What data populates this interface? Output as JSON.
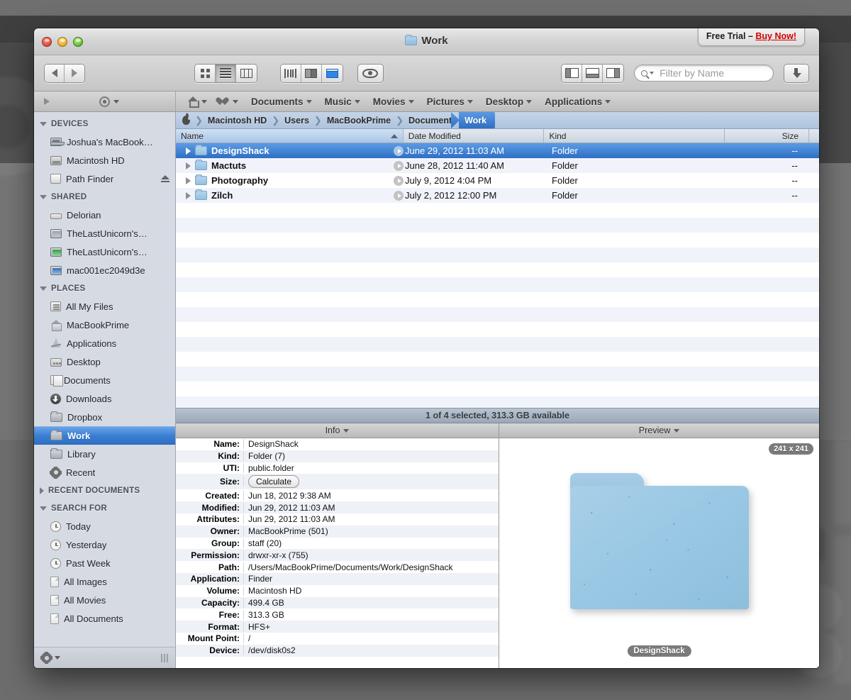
{
  "window": {
    "title": "Work",
    "trial": {
      "prefix": "Free Trial – ",
      "buy": "Buy Now!"
    }
  },
  "toolbar": {
    "back_label": "Back",
    "forward_label": "Forward",
    "view_icon_label": "Icon View",
    "view_list_label": "List View",
    "view_column_label": "Column View",
    "browser_slim_label": "Slim Browser",
    "browser_dual_label": "Dual Browser",
    "browser_single_label": "Single Browser",
    "preview_label": "Quick Look",
    "pane_left_label": "Toggle Left Pane",
    "pane_bottom_label": "Toggle Bottom Pane",
    "pane_right_label": "Toggle Right Pane",
    "search_placeholder": "Filter by Name",
    "drop_stack_label": "Drop Stack"
  },
  "shelf": {
    "items": [
      {
        "label": "Documents"
      },
      {
        "label": "Music"
      },
      {
        "label": "Movies"
      },
      {
        "label": "Pictures"
      },
      {
        "label": "Desktop"
      },
      {
        "label": "Applications"
      }
    ]
  },
  "sidebar": {
    "groups": [
      {
        "title": "DEVICES",
        "expanded": true,
        "items": [
          {
            "label": "Joshua's MacBook…",
            "icon": "laptop-icon",
            "eject": false
          },
          {
            "label": "Macintosh HD",
            "icon": "harddisk-icon",
            "eject": false
          },
          {
            "label": "Path Finder",
            "icon": "disk-icon",
            "eject": true
          }
        ]
      },
      {
        "title": "SHARED",
        "expanded": true,
        "items": [
          {
            "label": "Delorian",
            "icon": "server-icon",
            "eject": false
          },
          {
            "label": "TheLastUnicorn's…",
            "icon": "screen-gray-icon",
            "eject": false
          },
          {
            "label": "TheLastUnicorn's…",
            "icon": "screen-green-icon",
            "eject": false
          },
          {
            "label": "mac001ec2049d3e",
            "icon": "screen-blue-icon",
            "eject": false
          }
        ]
      },
      {
        "title": "PLACES",
        "expanded": true,
        "items": [
          {
            "label": "All My Files",
            "icon": "all-files-icon",
            "eject": false
          },
          {
            "label": "MacBookPrime",
            "icon": "home-icon",
            "eject": false
          },
          {
            "label": "Applications",
            "icon": "applications-icon",
            "eject": false
          },
          {
            "label": "Desktop",
            "icon": "desktop-icon",
            "eject": false
          },
          {
            "label": "Documents",
            "icon": "documents-icon",
            "eject": false
          },
          {
            "label": "Downloads",
            "icon": "downloads-icon",
            "eject": false
          },
          {
            "label": "Dropbox",
            "icon": "folder-icon",
            "eject": false
          },
          {
            "label": "Work",
            "icon": "folder-icon",
            "eject": false,
            "selected": true
          },
          {
            "label": "Library",
            "icon": "folder-icon",
            "eject": false
          },
          {
            "label": "Recent",
            "icon": "gear-icon",
            "eject": false
          }
        ]
      },
      {
        "title": "RECENT DOCUMENTS",
        "expanded": false,
        "items": []
      },
      {
        "title": "SEARCH FOR",
        "expanded": true,
        "items": [
          {
            "label": "Today",
            "icon": "clock-icon",
            "eject": false
          },
          {
            "label": "Yesterday",
            "icon": "clock-icon",
            "eject": false
          },
          {
            "label": "Past Week",
            "icon": "clock-icon",
            "eject": false
          },
          {
            "label": "All Images",
            "icon": "document-icon",
            "eject": false
          },
          {
            "label": "All Movies",
            "icon": "document-icon",
            "eject": false
          },
          {
            "label": "All Documents",
            "icon": "document-icon",
            "eject": false
          }
        ]
      }
    ],
    "footer_action": "action-gear-icon"
  },
  "breadcrumb": {
    "root_icon": "apple-icon",
    "items": [
      "Macintosh HD",
      "Users",
      "MacBookPrime",
      "Documents"
    ],
    "current": "Work",
    "separator": "❯"
  },
  "file_list": {
    "columns": {
      "name": "Name",
      "date_modified": "Date Modified",
      "kind": "Kind",
      "size": "Size"
    },
    "sort_column": "Name",
    "rows": [
      {
        "name": "DesignShack",
        "date": "June 29, 2012 11:03 AM",
        "kind": "Folder",
        "size": "--",
        "selected": true
      },
      {
        "name": "Mactuts",
        "date": "June 28, 2012 11:40 AM",
        "kind": "Folder",
        "size": "--",
        "selected": false
      },
      {
        "name": "Photography",
        "date": "July 9, 2012 4:04 PM",
        "kind": "Folder",
        "size": "--",
        "selected": false
      },
      {
        "name": "Zilch",
        "date": "July 2, 2012 12:00 PM",
        "kind": "Folder",
        "size": "--",
        "selected": false
      }
    ]
  },
  "status_bar": {
    "text": "1 of 4 selected, 313.3 GB available"
  },
  "info_pane": {
    "title": "Info",
    "size_button": "Calculate",
    "rows": [
      {
        "label": "Name:",
        "value": "DesignShack"
      },
      {
        "label": "Kind:",
        "value": "Folder (7)"
      },
      {
        "label": "UTI:",
        "value": "public.folder"
      },
      {
        "label": "Size:",
        "value": "",
        "button": "Calculate"
      },
      {
        "label": "Created:",
        "value": "Jun 18, 2012 9:38 AM"
      },
      {
        "label": "Modified:",
        "value": "Jun 29, 2012 11:03 AM"
      },
      {
        "label": "Attributes:",
        "value": "Jun 29, 2012 11:03 AM"
      },
      {
        "label": "Owner:",
        "value": "MacBookPrime (501)"
      },
      {
        "label": "Group:",
        "value": "staff (20)"
      },
      {
        "label": "Permission:",
        "value": "drwxr-xr-x (755)"
      },
      {
        "label": "Path:",
        "value": "/Users/MacBookPrime/Documents/Work/DesignShack"
      },
      {
        "label": "Application:",
        "value": "Finder"
      },
      {
        "label": "Volume:",
        "value": "Macintosh HD"
      },
      {
        "label": "Capacity:",
        "value": "499.4 GB"
      },
      {
        "label": "Free:",
        "value": "313.3 GB"
      },
      {
        "label": "Format:",
        "value": "HFS+"
      },
      {
        "label": "Mount Point:",
        "value": "/"
      },
      {
        "label": "Device:",
        "value": "/dev/disk0s2"
      }
    ]
  },
  "preview_pane": {
    "title": "Preview",
    "dimensions": "241 x 241",
    "item_name": "DesignShack"
  },
  "colors": {
    "selection_blue": "#2f6fc4",
    "buy_now_red": "#d40000",
    "folder_blue": "#9ac8e4",
    "sidebar_bg": "#d6dae2"
  }
}
